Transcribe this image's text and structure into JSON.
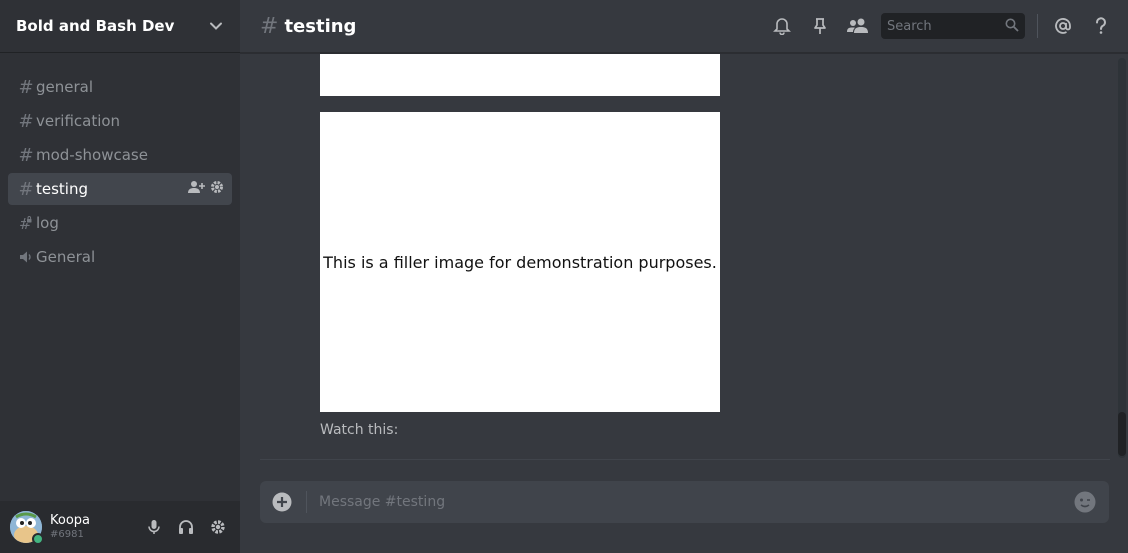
{
  "guild": {
    "name": "Bold and Bash Dev"
  },
  "channels": [
    {
      "name": "general",
      "type": "text"
    },
    {
      "name": "verification",
      "type": "text"
    },
    {
      "name": "mod-showcase",
      "type": "text"
    },
    {
      "name": "testing",
      "type": "text",
      "active": true
    },
    {
      "name": "log",
      "type": "locked-text"
    },
    {
      "name": "General",
      "type": "voice"
    }
  ],
  "header": {
    "hash": "#",
    "title": "testing",
    "search_placeholder": "Search",
    "icons": [
      "bell-icon",
      "pin-icon",
      "members-icon",
      "search-icon",
      "at-mention-icon",
      "help-icon"
    ]
  },
  "messages": {
    "image_caption": "This is a filler image for demonstration purposes.",
    "text": "Watch this:"
  },
  "composer": {
    "placeholder": "Message #testing"
  },
  "user": {
    "name": "Koopa",
    "tag": "#6981",
    "status_color": "#43b581"
  },
  "colors": {
    "sidebar": "#2f3136",
    "chat": "#36393f",
    "panel": "#292b2f",
    "active": "#42464d",
    "online": "#43b581"
  }
}
